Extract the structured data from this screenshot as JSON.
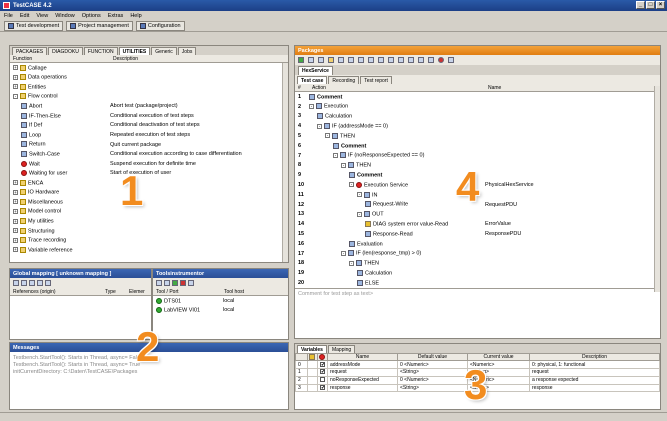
{
  "window": {
    "title": "TestCASE 4.2",
    "min": "_",
    "max": "□",
    "close": "×"
  },
  "menu": [
    "File",
    "Edit",
    "View",
    "Window",
    "Options",
    "Extras",
    "Help"
  ],
  "modes": [
    "Test development",
    "Project management",
    "Configuration"
  ],
  "library": {
    "tabs": [
      "PACKAGES",
      "DIAGDOKU",
      "FUNCTION",
      "UTILITIES",
      "Generic",
      "Jobs"
    ],
    "active_tab": 3,
    "col_function": "Function",
    "col_description": "Description",
    "items": [
      {
        "label": "Callage",
        "desc": "",
        "indent": 0,
        "exp": "+",
        "icon": "folder"
      },
      {
        "label": "Data operations",
        "desc": "",
        "indent": 0,
        "exp": "+",
        "icon": "folder"
      },
      {
        "label": "Entities",
        "desc": "",
        "indent": 0,
        "exp": "+",
        "icon": "folder"
      },
      {
        "label": "Flow control",
        "desc": "",
        "indent": 0,
        "exp": "-",
        "icon": "folder"
      },
      {
        "label": "Abort",
        "desc": "Abort test (package/project)",
        "indent": 2,
        "exp": "",
        "icon": "plain"
      },
      {
        "label": "IF-Then-Else",
        "desc": "Conditional execution of test steps",
        "indent": 2,
        "exp": "",
        "icon": "plain"
      },
      {
        "label": "If Def",
        "desc": "Conditional deactivation of test steps",
        "indent": 2,
        "exp": "",
        "icon": "plain"
      },
      {
        "label": "Loop",
        "desc": "Repeated execution of test steps",
        "indent": 2,
        "exp": "",
        "icon": "plain"
      },
      {
        "label": "Return",
        "desc": "Quit current package",
        "indent": 2,
        "exp": "",
        "icon": "plain"
      },
      {
        "label": "Switch-Case",
        "desc": "Conditional execution according to case differentiation",
        "indent": 2,
        "exp": "",
        "icon": "plain"
      },
      {
        "label": "Wait",
        "desc": "Suspend execution for definite time",
        "indent": 2,
        "exp": "",
        "icon": "red"
      },
      {
        "label": "Waiting for user",
        "desc": "Start of execution of user",
        "indent": 2,
        "exp": "",
        "icon": "red"
      },
      {
        "label": "ENCA",
        "desc": "",
        "indent": 0,
        "exp": "+",
        "icon": "folder"
      },
      {
        "label": "IO Hardware",
        "desc": "",
        "indent": 0,
        "exp": "+",
        "icon": "folder"
      },
      {
        "label": "Miscellaneous",
        "desc": "",
        "indent": 0,
        "exp": "+",
        "icon": "folder"
      },
      {
        "label": "Model control",
        "desc": "",
        "indent": 0,
        "exp": "+",
        "icon": "folder"
      },
      {
        "label": "My utilities",
        "desc": "",
        "indent": 0,
        "exp": "+",
        "icon": "folder"
      },
      {
        "label": "Structuring",
        "desc": "",
        "indent": 0,
        "exp": "+",
        "icon": "folder"
      },
      {
        "label": "Trace recording",
        "desc": "",
        "indent": 0,
        "exp": "+",
        "icon": "folder"
      },
      {
        "label": "Variable reference",
        "desc": "",
        "indent": 0,
        "exp": "+",
        "icon": "folder"
      }
    ]
  },
  "global_mapping": {
    "title": "Global mapping [ unknown mapping ]",
    "col_ref": "References (origin)",
    "col_type": "Type",
    "col_elem": "Elemer"
  },
  "toolsinstrumentor": {
    "title": "Toolsinstrumentor",
    "col_tool": "Tool / Port",
    "col_host": "Tool host",
    "rows": [
      {
        "tool": "DTS01",
        "host": "local"
      },
      {
        "tool": "LabVIEW VI01",
        "host": "local"
      }
    ]
  },
  "messages": {
    "title": "Messages",
    "lines": [
      "Testbench.StartTool(): Starts in Thread, async= False",
      "Testbench.StartTool(): Starts in Thread, async= True",
      "initCurrentDirectory: C:\\Daten\\TestCASE\\Packages"
    ]
  },
  "packages": {
    "title": "Packages",
    "doc_tab": "HexService",
    "subtabs": [
      "Test case",
      "Recording",
      "Test report"
    ],
    "col_num": "#",
    "col_action": "Action",
    "col_name": "Name",
    "steps": [
      {
        "n": "1",
        "indent": 0,
        "exp": "",
        "label": "Comment",
        "name": "",
        "bold": true,
        "icon": "plain"
      },
      {
        "n": "2",
        "indent": 0,
        "exp": "-",
        "label": "Execution",
        "name": "",
        "bold": false,
        "icon": "plain"
      },
      {
        "n": "3",
        "indent": 2,
        "exp": "",
        "label": "Calculation",
        "name": "",
        "bold": false,
        "icon": "plain"
      },
      {
        "n": "4",
        "indent": 2,
        "exp": "-",
        "label": "IF (addressMode == 0)",
        "name": "",
        "bold": false,
        "icon": "plain"
      },
      {
        "n": "5",
        "indent": 4,
        "exp": "-",
        "label": "THEN",
        "name": "",
        "bold": false,
        "icon": "plain"
      },
      {
        "n": "6",
        "indent": 6,
        "exp": "",
        "label": "Comment",
        "name": "",
        "bold": true,
        "icon": "plain"
      },
      {
        "n": "7",
        "indent": 6,
        "exp": "-",
        "label": "IF (noResponseExpected == 0)",
        "name": "",
        "bold": false,
        "icon": "plain"
      },
      {
        "n": "8",
        "indent": 8,
        "exp": "-",
        "label": "THEN",
        "name": "",
        "bold": false,
        "icon": "plain"
      },
      {
        "n": "9",
        "indent": 10,
        "exp": "",
        "label": "Comment",
        "name": "",
        "bold": true,
        "icon": "plain"
      },
      {
        "n": "10",
        "indent": 10,
        "exp": "-",
        "label": "Execution Service",
        "name": "PhysicalHexService",
        "bold": false,
        "icon": "red"
      },
      {
        "n": "11",
        "indent": 12,
        "exp": "-",
        "label": "IN",
        "name": "",
        "bold": false,
        "icon": "plain"
      },
      {
        "n": "12",
        "indent": 14,
        "exp": "",
        "label": "Request-Write",
        "name": "RequestPDU",
        "bold": false,
        "icon": "plain"
      },
      {
        "n": "13",
        "indent": 12,
        "exp": "-",
        "label": "OUT",
        "name": "",
        "bold": false,
        "icon": "plain"
      },
      {
        "n": "14",
        "indent": 14,
        "exp": "",
        "label": "DIAG system error value-Read",
        "name": "ErrorValue",
        "bold": false,
        "icon": "yellow"
      },
      {
        "n": "15",
        "indent": 14,
        "exp": "",
        "label": "Response-Read",
        "name": "ResponsePDU",
        "bold": false,
        "icon": "plain"
      },
      {
        "n": "16",
        "indent": 10,
        "exp": "",
        "label": "Evaluation",
        "name": "",
        "bold": false,
        "icon": "plain"
      },
      {
        "n": "17",
        "indent": 8,
        "exp": "-",
        "label": "IF (len(response_tmp) > 0)",
        "name": "",
        "bold": false,
        "icon": "plain"
      },
      {
        "n": "18",
        "indent": 10,
        "exp": "-",
        "label": "THEN",
        "name": "",
        "bold": false,
        "icon": "plain"
      },
      {
        "n": "19",
        "indent": 12,
        "exp": "",
        "label": "Calculation",
        "name": "",
        "bold": false,
        "icon": "plain"
      },
      {
        "n": "20",
        "indent": 12,
        "exp": "",
        "label": "ELSE",
        "name": "",
        "bold": false,
        "icon": "plain"
      }
    ],
    "comment_placeholder": "Comment for test step as text>"
  },
  "variables": {
    "tabs": [
      "Variables",
      "Mapping"
    ],
    "headers": [
      "",
      "",
      "",
      "Name",
      "Default value",
      "Current value",
      "Description"
    ],
    "rows": [
      {
        "n": "0",
        "c1": "",
        "c2": "✔",
        "name": "addressMode",
        "def": "0 <Numeric>",
        "cur": "<Numeric>",
        "desc": "0: physical, 1: functional"
      },
      {
        "n": "1",
        "c1": "",
        "c2": "✔",
        "name": "request",
        "def": "<String>",
        "cur": "<String>",
        "desc": "request"
      },
      {
        "n": "2",
        "c1": "",
        "c2": "",
        "name": "noResponseExpected",
        "def": "0 <Numeric>",
        "cur": "<Numeric>",
        "desc": "a response expected"
      },
      {
        "n": "3",
        "c1": "",
        "c2": "✔",
        "name": "response",
        "def": "<String>",
        "cur": "<String>",
        "desc": "response"
      }
    ]
  },
  "callouts": [
    "1",
    "2",
    "3",
    "4"
  ]
}
